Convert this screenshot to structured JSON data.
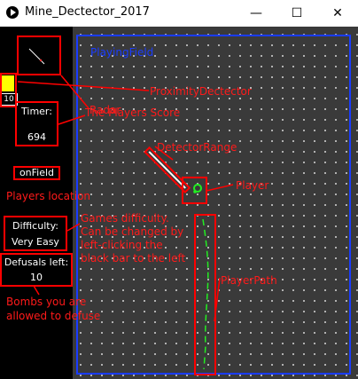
{
  "window": {
    "title": "Mine_Dectector_2017",
    "minimize": "—",
    "maximize": "☐",
    "close": "✕"
  },
  "hud": {
    "proximity_value": "10",
    "timer_label": "Timer:",
    "timer_value": "694",
    "location": "onField",
    "difficulty_label": "Difficulty:",
    "difficulty_value": "Very Easy",
    "defusals_label": "Defusals left:",
    "defusals_value": "10"
  },
  "annotations": {
    "playing_field": "PlayingField",
    "radar": "Radar",
    "proximity": "ProximityDectector",
    "score": "The Players Score",
    "detector_range": "DetectorRange",
    "player": "Player",
    "location": "Players location",
    "difficulty": [
      "Games difficulty.",
      "Can be changed by",
      "left-clicking the",
      "black bar to the left"
    ],
    "player_path": "PlayerPath",
    "bombs": [
      "Bombs you are",
      "allowed to defuse"
    ]
  },
  "colors": {
    "annotation": "#ff0000",
    "field_border": "#1a3cff",
    "player": "#22ee22",
    "proximity_indicator": "#ffff00"
  }
}
